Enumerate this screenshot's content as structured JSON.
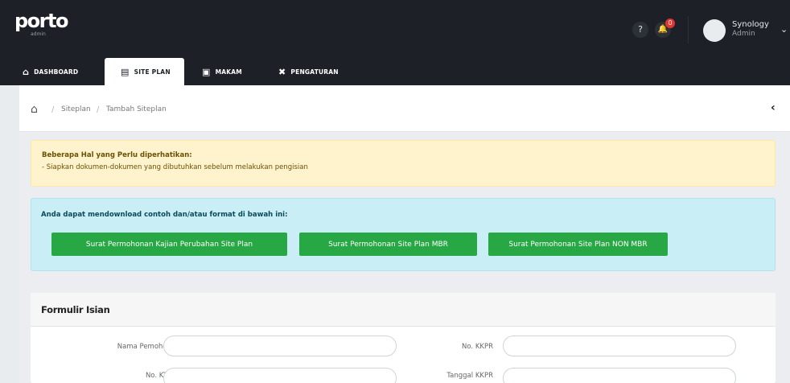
{
  "header": {
    "logo": "porto",
    "logo_sub": "admin",
    "help_label": "?",
    "notification_count": "0",
    "user_name": "Synology",
    "user_role": "Admin"
  },
  "nav": {
    "items": [
      {
        "label": "DASHBOARD",
        "icon": "home-icon"
      },
      {
        "label": "SITE PLAN",
        "icon": "building-icon"
      },
      {
        "label": "MAKAM",
        "icon": "bed-icon"
      },
      {
        "label": "PENGATURAN",
        "icon": "tools-icon"
      }
    ],
    "active": "SITE PLAN"
  },
  "breadcrumb": {
    "items": [
      "Siteplan",
      "Tambah Siteplan"
    ]
  },
  "notice": {
    "title": "Beberapa Hal yang Perlu diperhatikan:",
    "text": "- Siapkan dokumen-dokumen yang dibutuhkan sebelum melakukan pengisian"
  },
  "downloads": {
    "title": "Anda dapat mendownload contoh dan/atau format di bawah ini:",
    "buttons": [
      "Surat Permohonan Kajian Perubahan Site Plan",
      "Surat Permohonan Site Plan MBR",
      "Surat Permohonan Site Plan NON MBR"
    ]
  },
  "form": {
    "title": "Formulir Isian",
    "fields": {
      "nama_pemohon": {
        "label": "Nama Pemohon",
        "value": ""
      },
      "no_kkpr": {
        "label": "No. KKPR",
        "value": ""
      },
      "no_ktp": {
        "label": "No. KTP",
        "value": ""
      },
      "tanggal_kkpr": {
        "label": "Tanggal KKPR",
        "value": ""
      }
    }
  },
  "colors": {
    "topbar": "#1d2127",
    "warning_bg": "#fff3cd",
    "info_bg": "#c9eef6",
    "button_green": "#28a745",
    "badge_red": "#e3342f"
  }
}
